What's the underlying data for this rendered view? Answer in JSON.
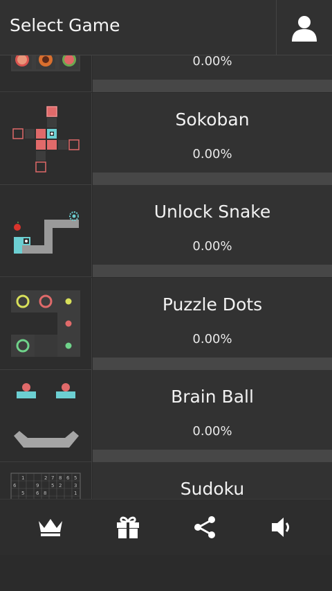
{
  "header": {
    "title": "Select Game",
    "profile_icon": "user-icon"
  },
  "games": [
    {
      "name": "",
      "progress_text": "0.00%",
      "progress": 0
    },
    {
      "name": "Sokoban",
      "progress_text": "0.00%",
      "progress": 0
    },
    {
      "name": "Unlock Snake",
      "progress_text": "0.00%",
      "progress": 0
    },
    {
      "name": "Puzzle Dots",
      "progress_text": "0.00%",
      "progress": 0
    },
    {
      "name": "Brain Ball",
      "progress_text": "0.00%",
      "progress": 0
    },
    {
      "name": "Sudoku",
      "progress_text": "",
      "progress": 0
    }
  ],
  "bottom_nav": [
    {
      "icon": "crown-icon"
    },
    {
      "icon": "gift-icon"
    },
    {
      "icon": "share-icon"
    },
    {
      "icon": "speaker-icon"
    }
  ],
  "colors": {
    "background": "#2b2b2b",
    "panel": "#323232",
    "progress_track": "#474747",
    "accent_red": "#e06a6a",
    "accent_cyan": "#6ccfd2",
    "accent_yellow": "#d8e05a",
    "accent_green": "#6fd38a"
  }
}
